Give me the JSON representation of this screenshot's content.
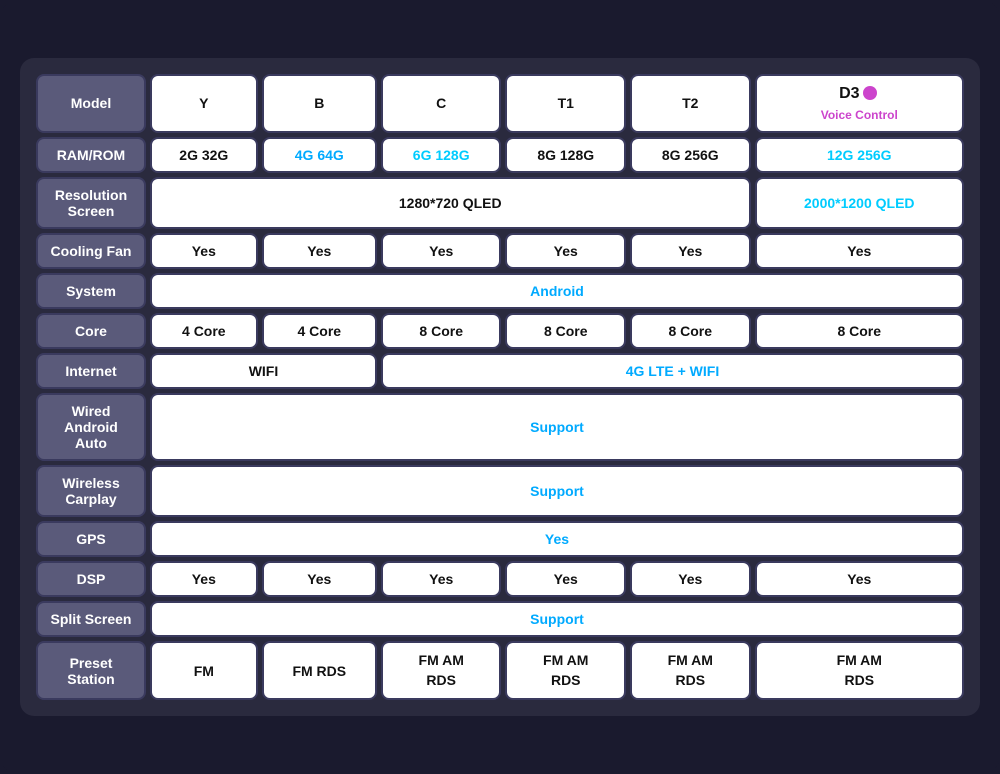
{
  "table": {
    "rows": [
      {
        "label": "Model",
        "cells": [
          "Y",
          "B",
          "C",
          "T1",
          "T2"
        ],
        "last_cell_special": true,
        "last_cell_main": "D3",
        "last_cell_sub": "Voice Control"
      },
      {
        "label": "RAM/ROM",
        "cells": [
          "2G 32G",
          "4G 64G",
          "6G 128G",
          "8G 128G",
          "8G 256G",
          "12G 256G"
        ],
        "cells_blue": [
          false,
          true,
          true,
          false,
          false,
          true
        ]
      },
      {
        "label": "Resolution\nScreen",
        "span_cells": [
          {
            "text": "1280*720 QLED",
            "cols": 5,
            "blue": false
          },
          {
            "text": "2000*1200 QLED",
            "cols": 1,
            "blue": true
          }
        ]
      },
      {
        "label": "Cooling Fan",
        "cells": [
          "Yes",
          "Yes",
          "Yes",
          "Yes",
          "Yes",
          "Yes"
        ]
      },
      {
        "label": "System",
        "span_text": "Android",
        "span_cols": 6,
        "span_blue": true
      },
      {
        "label": "Core",
        "cells": [
          "4 Core",
          "4 Core",
          "8 Core",
          "8 Core",
          "8 Core",
          "8 Core"
        ]
      },
      {
        "label": "Internet",
        "span_cells": [
          {
            "text": "WIFI",
            "cols": 2,
            "blue": false
          },
          {
            "text": "4G LTE + WIFI",
            "cols": 4,
            "blue": true
          }
        ]
      },
      {
        "label": "Wired Android\nAuto",
        "span_text": "Support",
        "span_cols": 6,
        "span_blue": true
      },
      {
        "label": "Wireless\nCarplay",
        "span_text": "Support",
        "span_cols": 6,
        "span_blue": true
      },
      {
        "label": "GPS",
        "span_text": "Yes",
        "span_cols": 6,
        "span_blue": true
      },
      {
        "label": "DSP",
        "cells": [
          "Yes",
          "Yes",
          "Yes",
          "Yes",
          "Yes",
          "Yes"
        ]
      },
      {
        "label": "Split Screen",
        "span_text": "Support",
        "span_cols": 6,
        "span_blue": true
      },
      {
        "label": "Preset Station",
        "cells": [
          "FM",
          "FM RDS",
          "FM AM\nRDS",
          "FM AM\nRDS",
          "FM AM\nRDS",
          "FM AM\nRDS"
        ]
      }
    ]
  }
}
